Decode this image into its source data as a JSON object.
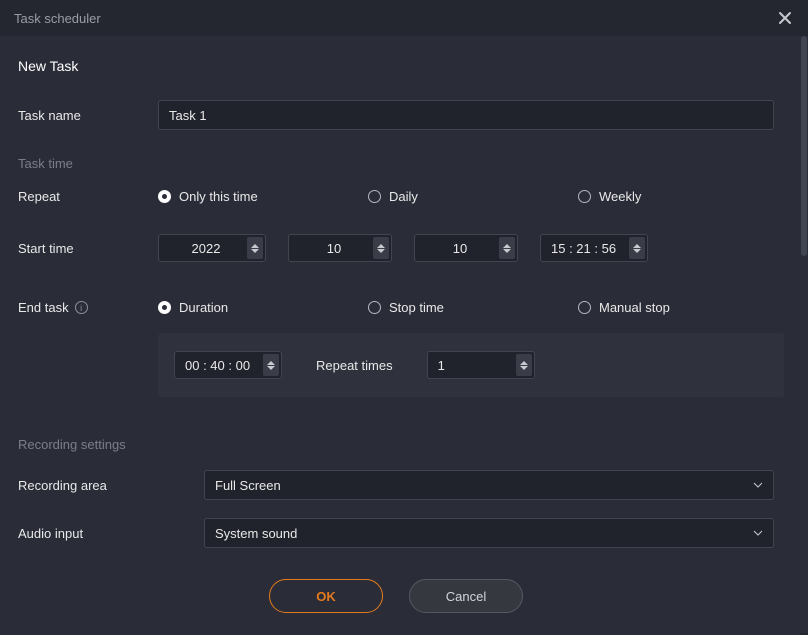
{
  "window": {
    "title": "Task scheduler"
  },
  "page": {
    "title": "New Task"
  },
  "task_name": {
    "label": "Task name",
    "value": "Task 1"
  },
  "task_time": {
    "section": "Task time",
    "repeat": {
      "label": "Repeat",
      "options": {
        "only": "Only this time",
        "daily": "Daily",
        "weekly": "Weekly"
      },
      "selected": "only"
    },
    "start": {
      "label": "Start time",
      "year": "2022",
      "month": "10",
      "day": "10",
      "clock": "15 : 21 : 56"
    },
    "end": {
      "label": "End task",
      "options": {
        "duration": "Duration",
        "stop": "Stop time",
        "manual": "Manual stop"
      },
      "selected": "duration"
    },
    "duration": {
      "value": "00 : 40 : 00",
      "repeat_label": "Repeat times",
      "repeat_value": "1"
    }
  },
  "recording": {
    "section": "Recording settings",
    "area": {
      "label": "Recording area",
      "value": "Full Screen"
    },
    "audio": {
      "label": "Audio input",
      "value": "System sound"
    }
  },
  "footer": {
    "ok": "OK",
    "cancel": "Cancel"
  }
}
